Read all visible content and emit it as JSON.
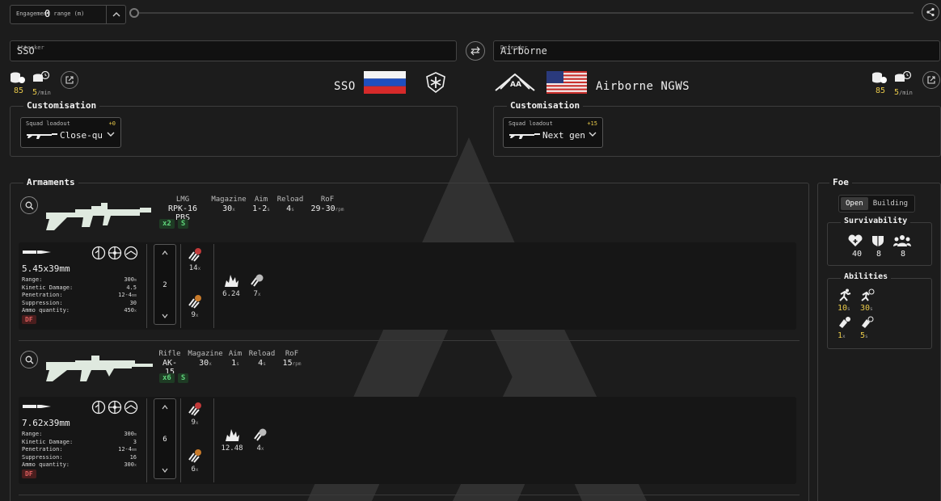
{
  "range": {
    "label": "Engagement range (m)",
    "value": "0"
  },
  "attacker": {
    "field_label": "Attacker",
    "value": "SSO",
    "name": "SSO",
    "resources": {
      "cost": "85",
      "income": "5",
      "income_unit": "/min"
    }
  },
  "defender": {
    "field_label": "Defender",
    "value": "Airborne",
    "name": "Airborne NGWS",
    "resources": {
      "cost": "85",
      "income": "5",
      "income_unit": "/min"
    }
  },
  "customisation": {
    "title": "Customisation",
    "attacker_loadout": {
      "label": "Squad loadout",
      "cost": "+0",
      "name": "Close-quarters"
    },
    "defender_loadout": {
      "label": "Squad loadout",
      "cost": "+15",
      "name": "Next generation"
    }
  },
  "armaments": {
    "title": "Armaments",
    "headers": {
      "class": "",
      "magazine": "Magazine",
      "aim": "Aim",
      "reload": "Reload",
      "rof": "RoF"
    },
    "weapons": [
      {
        "class": "LMG",
        "name": "RPK-16 PBS",
        "magazine": "30",
        "mag_unit": "x",
        "aim": "1-2",
        "aim_unit": "s",
        "reload": "4",
        "reload_unit": "s",
        "rof": "29-30",
        "rof_unit": "rpm",
        "count_badge": "x2",
        "tag_badge": "S",
        "ammo": {
          "caliber": "5.45x39mm",
          "stats": [
            {
              "k": "Range:",
              "v": "300",
              "u": "m"
            },
            {
              "k": "Kinetic Damage:",
              "v": "4.5",
              "u": ""
            },
            {
              "k": "Penetration:",
              "v": "12-4",
              "u": "mm"
            },
            {
              "k": "Suppression:",
              "v": "30",
              "u": ""
            },
            {
              "k": "Ammo quantity:",
              "v": "450",
              "u": "x"
            }
          ],
          "tag": "DF"
        },
        "stepper": "2",
        "hits_top": "14",
        "hits_bottom": "9",
        "damage": "6.24",
        "kills": "7"
      },
      {
        "class": "Rifle",
        "name": "AK-15",
        "magazine": "30",
        "mag_unit": "x",
        "aim": "1",
        "aim_unit": "s",
        "reload": "4",
        "reload_unit": "s",
        "rof": "15",
        "rof_unit": "rpm",
        "count_badge": "x6",
        "tag_badge": "S",
        "ammo": {
          "caliber": "7.62x39mm",
          "stats": [
            {
              "k": "Range:",
              "v": "300",
              "u": "m"
            },
            {
              "k": "Kinetic Damage:",
              "v": "3",
              "u": ""
            },
            {
              "k": "Penetration:",
              "v": "12-4",
              "u": "mm"
            },
            {
              "k": "Suppression:",
              "v": "16",
              "u": ""
            },
            {
              "k": "Ammo quantity:",
              "v": "300",
              "u": "x"
            }
          ],
          "tag": "DF"
        },
        "stepper": "6",
        "hits_top": "9",
        "hits_bottom": "6",
        "damage": "12.48",
        "kills": "4"
      }
    ]
  },
  "foe": {
    "title": "Foe",
    "toggle": {
      "open": "Open",
      "building": "Building"
    },
    "survivability": {
      "title": "Survivability",
      "health": "40",
      "armor": "8",
      "squad": "8"
    },
    "abilities": {
      "title": "Abilities",
      "a1": "10",
      "a1_unit": "s",
      "a2": "30",
      "a2_unit": "s",
      "a3": "1",
      "a3_unit": "x",
      "a4": "5",
      "a4_unit": "s"
    }
  },
  "colors": {
    "accent": "#e8c94a",
    "green": "#5fd27a",
    "red": "#e06060",
    "bg": "#1c1c1c"
  }
}
